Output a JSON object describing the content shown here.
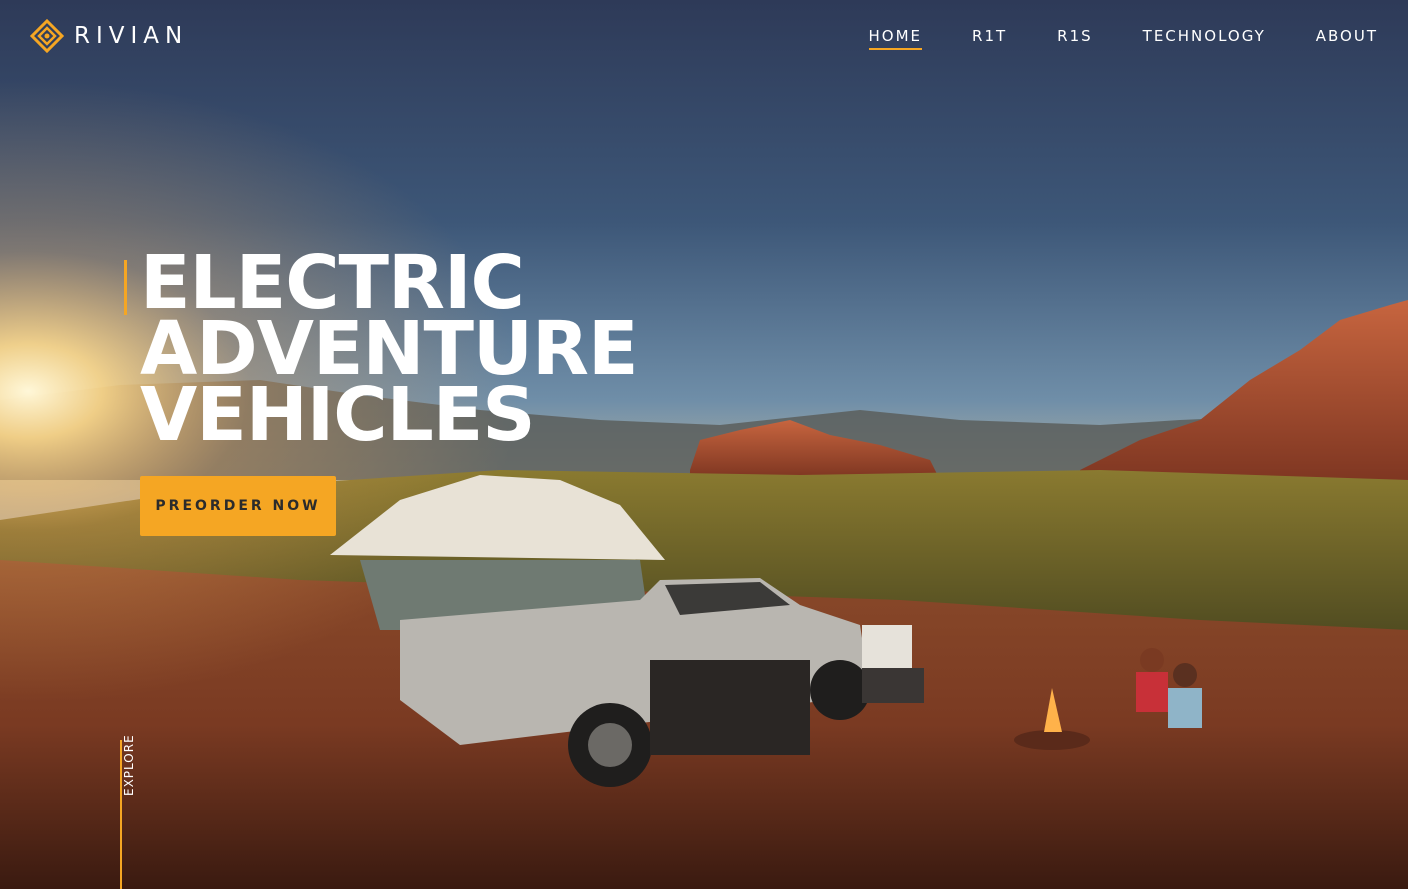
{
  "brand": {
    "name": "RIVIAN",
    "accent_color": "#f5a623"
  },
  "nav": {
    "items": [
      {
        "label": "HOME",
        "active": true
      },
      {
        "label": "R1T",
        "active": false
      },
      {
        "label": "R1S",
        "active": false
      },
      {
        "label": "TECHNOLOGY",
        "active": false
      },
      {
        "label": "ABOUT",
        "active": false
      }
    ]
  },
  "hero": {
    "headline": [
      "ELECTRIC",
      "ADVENTURE",
      "VEHICLES"
    ],
    "cta_label": "PREORDER NOW",
    "explore_label": "EXPLORE",
    "image_icon": "desert-campsite-photo"
  }
}
